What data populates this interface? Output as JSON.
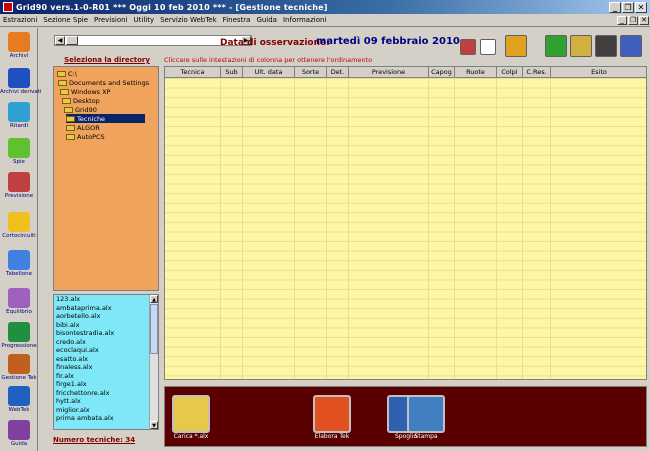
{
  "window": {
    "title": "Grid90 vers.1-0-R01  ***  Oggi 10 feb 2010  ***  - [Gestione tecniche]",
    "minimize": "_",
    "restore": "❐",
    "close": "✕"
  },
  "menu": [
    "Estrazioni",
    "Sezione Spie",
    "Previsioni",
    "Utility",
    "Servizio WebTek",
    "Finestra",
    "Guida",
    "Informazioni"
  ],
  "mdi_controls": [
    "_",
    "❐",
    "✕"
  ],
  "sidebar": [
    {
      "label": "Archivi",
      "icon": "pencil-icon",
      "color": "#e87a20"
    },
    {
      "label": "Archivi derivati",
      "icon": "edit-window-icon",
      "color": "#2050c0"
    },
    {
      "label": "Ritardi",
      "icon": "clock-icon",
      "color": "#30a0d0"
    },
    {
      "label": "Spie",
      "icon": "binoculars-icon",
      "color": "#60c030"
    },
    {
      "label": "Previsione",
      "icon": "gears-icon",
      "color": "#c04040"
    },
    {
      "label": "Cortocircuiti",
      "icon": "lightbulb-icon",
      "color": "#f0c020"
    },
    {
      "label": "Tabellone",
      "icon": "calendar-icon",
      "color": "#4080e0"
    },
    {
      "label": "Equilibrio",
      "icon": "scales-icon",
      "color": "#a060c0"
    },
    {
      "label": "Progressione",
      "icon": "dollar-icon",
      "color": "#209040"
    },
    {
      "label": "Gestione Tek",
      "icon": "tools-icon",
      "color": "#c06020"
    },
    {
      "label": "WebTek",
      "icon": "globe-icon",
      "color": "#2060c0"
    },
    {
      "label": "Guida",
      "icon": "book-icon",
      "color": "#8040a0"
    }
  ],
  "observation": {
    "label": "Data di osservazione:",
    "date": "martedì 09 febbraio 2010"
  },
  "toolbar_icons": [
    {
      "name": "no-entry-icon",
      "color": "#c04040"
    },
    {
      "name": "checkbox-icon",
      "color": "#ffffff"
    },
    {
      "name": "bucket-icon",
      "color": "#e0a020"
    },
    {
      "name": "add-icon",
      "color": "#30a030"
    },
    {
      "name": "pencil-tool-icon",
      "color": "#d0b040"
    },
    {
      "name": "save-disk-icon",
      "color": "#404040"
    },
    {
      "name": "tick-pencil-icon",
      "color": "#4060c0"
    }
  ],
  "directory": {
    "title": "Seleziona la directory",
    "items": [
      {
        "label": "C:\\"
      },
      {
        "label": "Documents and Settings"
      },
      {
        "label": "Windows XP"
      },
      {
        "label": "Desktop"
      },
      {
        "label": "Grid90"
      },
      {
        "label": "Tecniche"
      },
      {
        "label": "ALGOR"
      },
      {
        "label": "AutoPCS"
      }
    ],
    "selected_index": 5
  },
  "files": [
    "123.alx",
    "ambataprima.alx",
    "aorbetello.alx",
    "bibi.alx",
    "bisontestradia.alx",
    "credo.alx",
    "ecoclaqui.alx",
    "esatto.alx",
    "finaless.alx",
    "fir.alx",
    "firge1.alx",
    "fricchettonre.alx",
    "hytt.alx",
    "miglior.alx",
    "prima ambata.alx"
  ],
  "num_tecniche": "Numero tecniche: 34",
  "grid": {
    "hint": "Cliccare sulle intestazioni di colonna per ottenere l'ordinamento",
    "columns": [
      "Tecnica",
      "Sub",
      "Ult. data",
      "Sorte",
      "Det.",
      "Previsione",
      "Capog",
      "Ruote",
      "Colpi",
      "C.Res.",
      "Esito"
    ]
  },
  "actions": [
    {
      "label": "Carica *.alx",
      "icon": "folder-add-icon",
      "color": "#e8c84a"
    },
    {
      "label": "Elabora Tek",
      "icon": "record-icon",
      "color": "#e05020"
    },
    {
      "label": "Spoglio",
      "icon": "windows-icon",
      "color": "#3060b0"
    },
    {
      "label": "Stampa",
      "icon": "printer-icon",
      "color": "#4080c0"
    }
  ]
}
